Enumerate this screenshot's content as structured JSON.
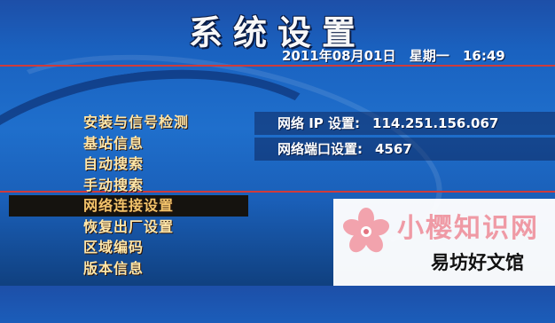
{
  "header": {
    "title": "系统设置",
    "date": "2011年08月01日",
    "weekday": "星期一",
    "time": "16:49"
  },
  "menu": {
    "items": [
      {
        "label": "安装与信号检测"
      },
      {
        "label": "基站信息"
      },
      {
        "label": "自动搜索"
      },
      {
        "label": "手动搜索"
      },
      {
        "label": "网络连接设置",
        "selected": true
      },
      {
        "label": "恢复出厂设置"
      },
      {
        "label": "区域编码"
      },
      {
        "label": "版本信息"
      }
    ]
  },
  "settings": {
    "ip": {
      "label": "网络 IP 设置:",
      "value": "114.251.156.067"
    },
    "port": {
      "label": "网络端口设置:",
      "value": "4567"
    }
  },
  "watermark": {
    "brand": "小樱知识网",
    "site": "易坊好文馆",
    "color": "#ef9aa5"
  }
}
